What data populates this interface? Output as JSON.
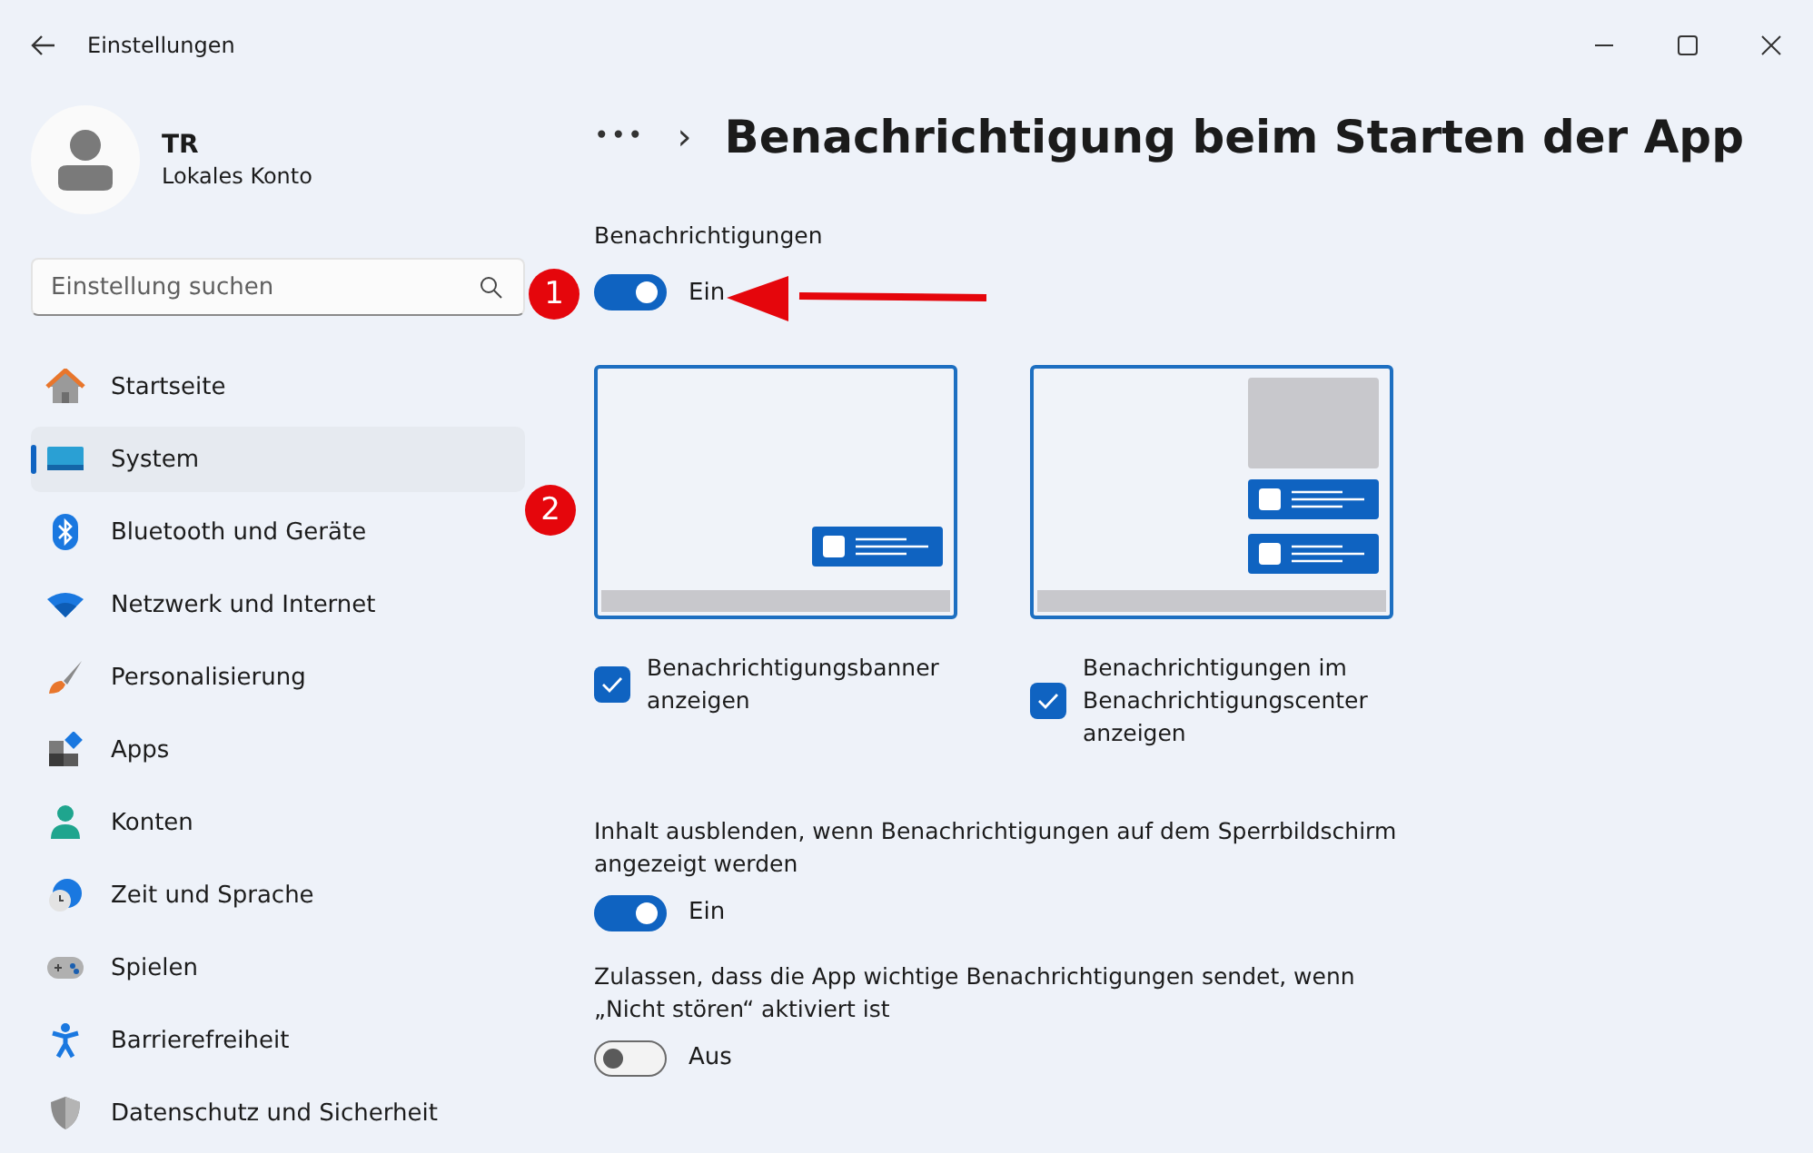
{
  "window": {
    "title": "Einstellungen"
  },
  "account": {
    "name": "TR",
    "type": "Lokales Konto"
  },
  "search": {
    "placeholder": "Einstellung suchen"
  },
  "sidebar": {
    "items": [
      {
        "label": "Startseite",
        "selected": false
      },
      {
        "label": "System",
        "selected": true
      },
      {
        "label": "Bluetooth und Geräte",
        "selected": false
      },
      {
        "label": "Netzwerk und Internet",
        "selected": false
      },
      {
        "label": "Personalisierung",
        "selected": false
      },
      {
        "label": "Apps",
        "selected": false
      },
      {
        "label": "Konten",
        "selected": false
      },
      {
        "label": "Zeit und Sprache",
        "selected": false
      },
      {
        "label": "Spielen",
        "selected": false
      },
      {
        "label": "Barrierefreiheit",
        "selected": false
      },
      {
        "label": "Datenschutz und Sicherheit",
        "selected": false
      }
    ]
  },
  "breadcrumb": {
    "more": "•••",
    "separator": "›",
    "title": "Benachrichtigung beim Starten der App"
  },
  "notifications": {
    "label": "Benachrichtigungen",
    "on": true,
    "state": "Ein"
  },
  "previews": [
    {
      "kind": "banner",
      "checked": true,
      "label": "Benachrichtigungsbanner anzeigen"
    },
    {
      "kind": "center",
      "checked": true,
      "label": "Benachrichtigungen im Benachrichtigungscenter anzeigen"
    }
  ],
  "settings": [
    {
      "label": "Inhalt ausblenden, wenn Benachrichtigungen auf dem Sperrbildschirm angezeigt werden",
      "on": true,
      "state": "Ein"
    },
    {
      "label": "Zulassen, dass die App wichtige Benachrichtigungen sendet, wenn „Nicht stören“ aktiviert ist",
      "on": false,
      "state": "Aus"
    }
  ],
  "annotations": [
    {
      "number": "1"
    },
    {
      "number": "2"
    }
  ]
}
